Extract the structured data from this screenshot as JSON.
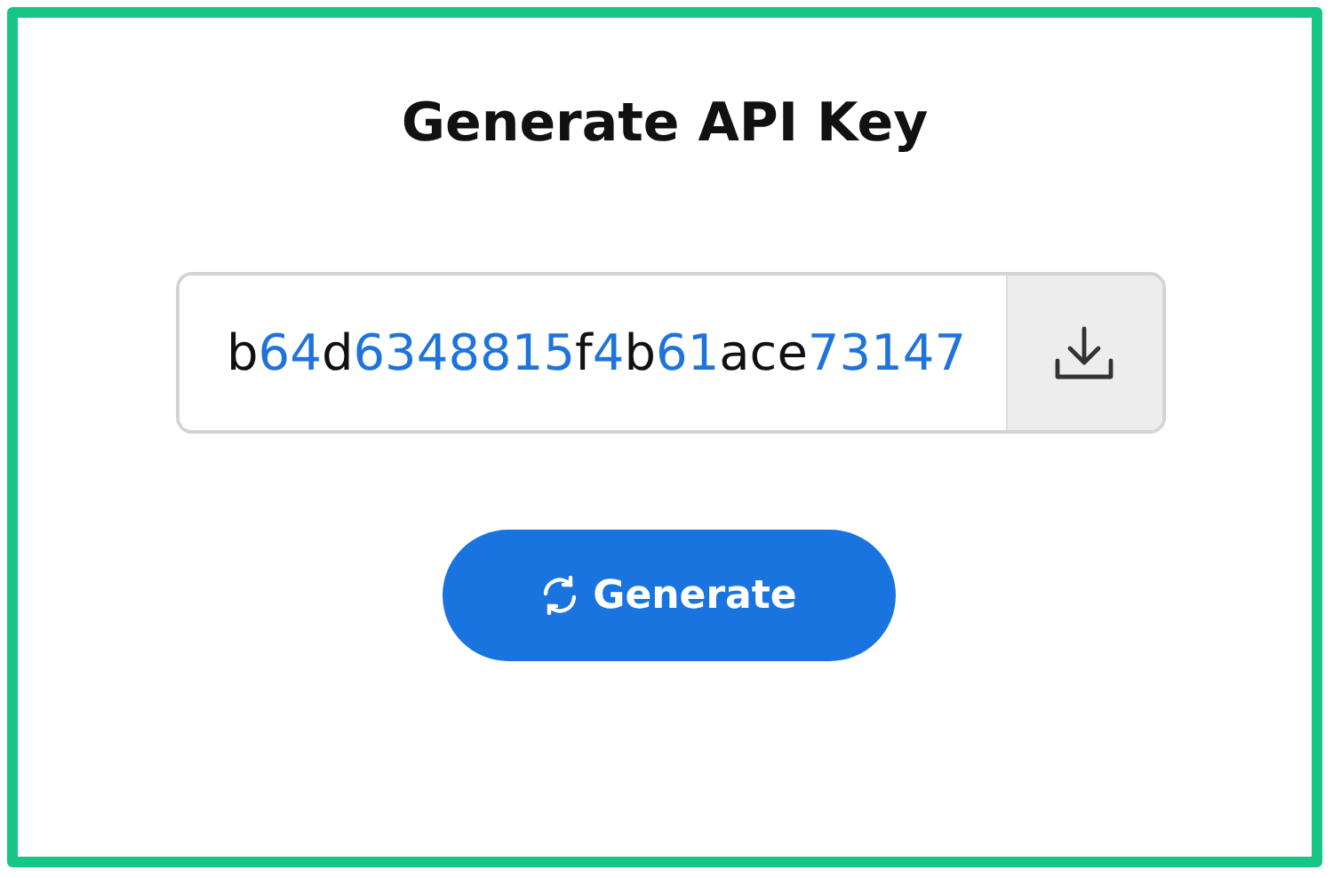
{
  "title": "Generate API Key",
  "key_field": {
    "value": "b64d6348815f4b61ace73147"
  },
  "generate_button": {
    "label": "Generate"
  }
}
